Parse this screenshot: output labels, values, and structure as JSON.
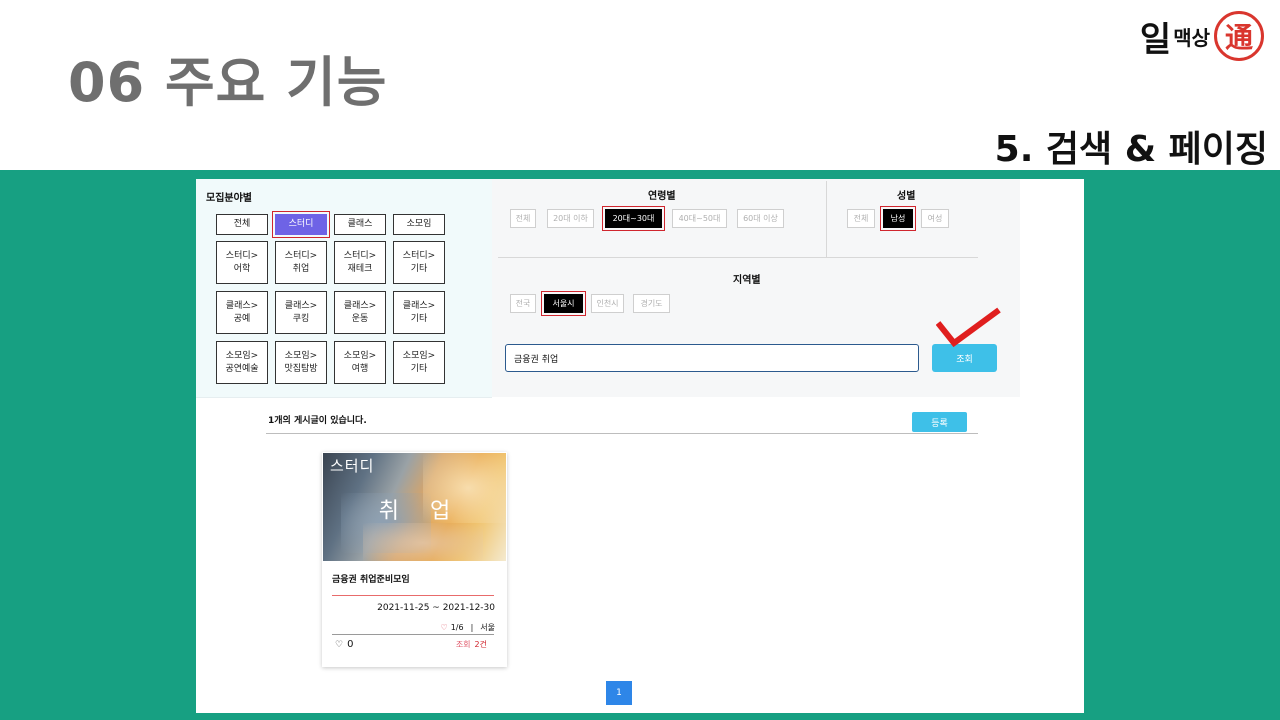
{
  "slide": {
    "title": "06 주요 기능",
    "section": "5. 검색 & 페이징",
    "logo": {
      "big": "일",
      "small": "맥상",
      "seal": "通"
    }
  },
  "category_filter": {
    "header": "모집분야별",
    "options": [
      {
        "label": "전체"
      },
      {
        "label": "스터디",
        "selected": true
      },
      {
        "label": "클래스"
      },
      {
        "label": "소모임"
      },
      {
        "label": "스터디>\n어학"
      },
      {
        "label": "스터디>\n취업"
      },
      {
        "label": "스터디>\n재테크"
      },
      {
        "label": "스터디>\n기타"
      },
      {
        "label": "클래스>\n공예"
      },
      {
        "label": "클래스>\n쿠킹"
      },
      {
        "label": "클래스>\n운동"
      },
      {
        "label": "클래스>\n기타"
      },
      {
        "label": "소모임>\n공연예술"
      },
      {
        "label": "소모임>\n맛집탐방"
      },
      {
        "label": "소모임>\n여행"
      },
      {
        "label": "소모임>\n기타"
      }
    ]
  },
  "age_filter": {
    "header": "연령별",
    "options": [
      {
        "label": "전체"
      },
      {
        "label": "20대 이하"
      },
      {
        "label": "20대~30대",
        "selected": true
      },
      {
        "label": "40대~50대"
      },
      {
        "label": "60대 이상"
      }
    ]
  },
  "gender_filter": {
    "header": "성별",
    "options": [
      {
        "label": "전체"
      },
      {
        "label": "남성",
        "selected": true
      },
      {
        "label": "여성"
      }
    ]
  },
  "region_filter": {
    "header": "지역별",
    "options": [
      {
        "label": "전국"
      },
      {
        "label": "서울시",
        "selected": true
      },
      {
        "label": "인천시"
      },
      {
        "label": "경기도"
      }
    ]
  },
  "search": {
    "value": "금융권 취업",
    "button": "조회"
  },
  "results": {
    "count_text": "1개의 게시글이 있습니다.",
    "register_button": "등록"
  },
  "card": {
    "category": "스터디",
    "subcategory": "취 업",
    "title": "금융권 취업준비모임",
    "date": "2021-11-25 ~ 2021-12-30",
    "members": "1/6",
    "separator": "|",
    "location": "서울",
    "likes": "0",
    "views_label": "조회",
    "views": "2건"
  },
  "pagination": {
    "current": "1"
  },
  "colors": {
    "band": "#17a082",
    "selected_category": "#6e63e6",
    "selected_filter": "#000000",
    "highlight_outline": "#d0262e",
    "button_blue": "#3ec0e8",
    "page_blue": "#2e86e8",
    "check_red": "#e01e1e"
  }
}
